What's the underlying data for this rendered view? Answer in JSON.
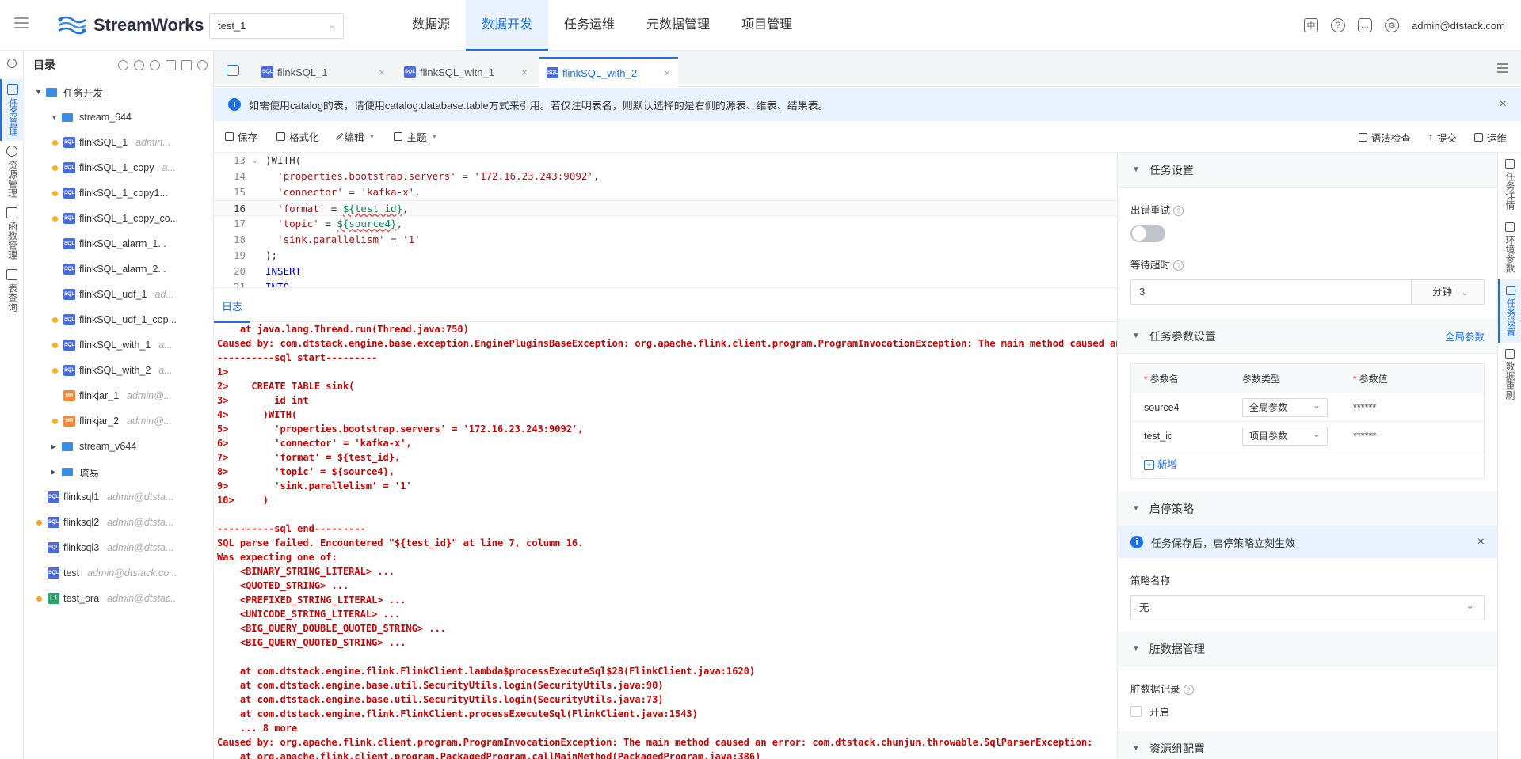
{
  "header": {
    "brand": "StreamWorks",
    "project": "test_1",
    "nav": [
      "数据源",
      "数据开发",
      "任务运维",
      "元数据管理",
      "项目管理"
    ],
    "active_nav": 1,
    "user": "admin@dtstack.com"
  },
  "rail": {
    "items": [
      "任务管理",
      "资源管理",
      "函数管理",
      "表查询"
    ]
  },
  "catalog": {
    "title": "目录",
    "tree": [
      {
        "label": "任务开发",
        "type": "folder"
      },
      {
        "label": "stream_644",
        "type": "folder"
      },
      {
        "label": "flinkSQL_1",
        "owner": "admin...",
        "badge": "SQL"
      },
      {
        "label": "flinkSQL_1_copy",
        "owner": "a...",
        "badge": "SQL"
      },
      {
        "label": "flinkSQL_1_copy1...",
        "owner": "",
        "badge": "SQL"
      },
      {
        "label": "flinkSQL_1_copy_co...",
        "owner": "",
        "badge": "SQL"
      },
      {
        "label": "flinkSQL_alarm_1...",
        "owner": "",
        "badge": "SQL"
      },
      {
        "label": "flinkSQL_alarm_2...",
        "owner": "",
        "badge": "SQL"
      },
      {
        "label": "flinkSQL_udf_1",
        "owner": "ad...",
        "badge": "SQL"
      },
      {
        "label": "flinkSQL_udf_1_cop...",
        "owner": "",
        "badge": "SQL"
      },
      {
        "label": "flinkSQL_with_1",
        "owner": "a...",
        "badge": "SQL"
      },
      {
        "label": "flinkSQL_with_2",
        "owner": "a...",
        "badge": "SQL"
      },
      {
        "label": "flinkjar_1",
        "owner": "admin@...",
        "badge": "MR"
      },
      {
        "label": "flinkjar_2",
        "owner": "admin@...",
        "badge": "MR"
      },
      {
        "label": "stream_v644",
        "type": "folder"
      },
      {
        "label": "琉易",
        "type": "folder"
      },
      {
        "label": "flinksql1",
        "owner": "admin@dtsta...",
        "badge": "SQL"
      },
      {
        "label": "flinksql2",
        "owner": "admin@dtsta...",
        "badge": "SQL"
      },
      {
        "label": "flinksql3",
        "owner": "admin@dtsta...",
        "badge": "SQL"
      },
      {
        "label": "test",
        "owner": "admin@dtstack.co...",
        "badge": "SQL"
      },
      {
        "label": "test_ora",
        "owner": "admin@dtstac...",
        "badge": "DAG"
      }
    ]
  },
  "tabs": [
    "flinkSQL_1",
    "flinkSQL_with_1",
    "flinkSQL_with_2"
  ],
  "notice": "如需使用catalog的表，请使用catalog.database.table方式来引用。若仅注明表名，则默认选择的是右侧的源表、维表、结果表。",
  "toolbar": {
    "left": [
      "保存",
      "格式化",
      "编辑",
      "主题"
    ],
    "right": [
      "语法检查",
      "提交",
      "运维"
    ]
  },
  "code": [
    {
      "n": "13",
      "t": ")WITH("
    },
    {
      "n": "14",
      "t": "  'properties.bootstrap.servers' = '172.16.23.243:9092',"
    },
    {
      "n": "15",
      "t": "  'connector' = 'kafka-x',"
    },
    {
      "n": "16",
      "t": "  'format' = ${test_id},"
    },
    {
      "n": "17",
      "t": "  'topic' = ${source4},"
    },
    {
      "n": "18",
      "t": "  'sink.parallelism' = '1'"
    },
    {
      "n": "19",
      "t": ");"
    },
    {
      "n": "20",
      "t": "INSERT"
    },
    {
      "n": "21",
      "t": "INTO"
    }
  ],
  "log_tab": "日志",
  "log": [
    "    at java.lang.Thread.run(Thread.java:750)",
    "Caused by: com.dtstack.engine.base.exception.EnginePluginsBaseException: org.apache.flink.client.program.ProgramInvocationException: The main method caused an",
    "----------sql start---------",
    "1>",
    "2>    CREATE TABLE sink(",
    "3>        id int",
    "4>      )WITH(",
    "5>        'properties.bootstrap.servers' = '172.16.23.243:9092',",
    "6>        'connector' = 'kafka-x',",
    "7>        'format' = ${test_id},",
    "8>        'topic' = ${source4},",
    "9>        'sink.parallelism' = '1'",
    "10>     )",
    "",
    "----------sql end---------",
    "SQL parse failed. Encountered \"${test_id}\" at line 7, column 16.",
    "Was expecting one of:",
    "    <BINARY_STRING_LITERAL> ...",
    "    <QUOTED_STRING> ...",
    "    <PREFIXED_STRING_LITERAL> ...",
    "    <UNICODE_STRING_LITERAL> ...",
    "    <BIG_QUERY_DOUBLE_QUOTED_STRING> ...",
    "    <BIG_QUERY_QUOTED_STRING> ...",
    "",
    "    at com.dtstack.engine.flink.FlinkClient.lambda$processExecuteSql$28(FlinkClient.java:1620)",
    "    at com.dtstack.engine.base.util.SecurityUtils.login(SecurityUtils.java:90)",
    "    at com.dtstack.engine.base.util.SecurityUtils.login(SecurityUtils.java:73)",
    "    at com.dtstack.engine.flink.FlinkClient.processExecuteSql(FlinkClient.java:1543)",
    "    ... 8 more",
    "Caused by: org.apache.flink.client.program.ProgramInvocationException: The main method caused an error: com.dtstack.chunjun.throwable.SqlParserException:",
    "    at org.apache.flink.client.program.PackagedProgram.callMainMethod(PackagedProgram.java:386)"
  ],
  "settings": {
    "task_settings": "任务设置",
    "retry_label": "出错重试",
    "timeout_label": "等待超时",
    "timeout_value": "3",
    "timeout_unit": "分钟",
    "params_title": "任务参数设置",
    "global_params_link": "全局参数",
    "param_headers": [
      "参数名",
      "参数类型",
      "参数值"
    ],
    "params": [
      {
        "name": "source4",
        "type": "全局参数",
        "value": "******"
      },
      {
        "name": "test_id",
        "type": "项目参数",
        "value": "******"
      }
    ],
    "add_label": "新增",
    "start_stop_title": "启停策略",
    "start_stop_notice": "任务保存后，启停策略立刻生效",
    "strategy_label": "策略名称",
    "strategy_value": "无",
    "dirty_title": "脏数据管理",
    "dirty_label": "脏数据记录",
    "dirty_checkbox": "开启",
    "resource_title": "资源组配置"
  },
  "vtabs": [
    "任务详情",
    "环境参数",
    "任务设置",
    "数据重刷"
  ]
}
